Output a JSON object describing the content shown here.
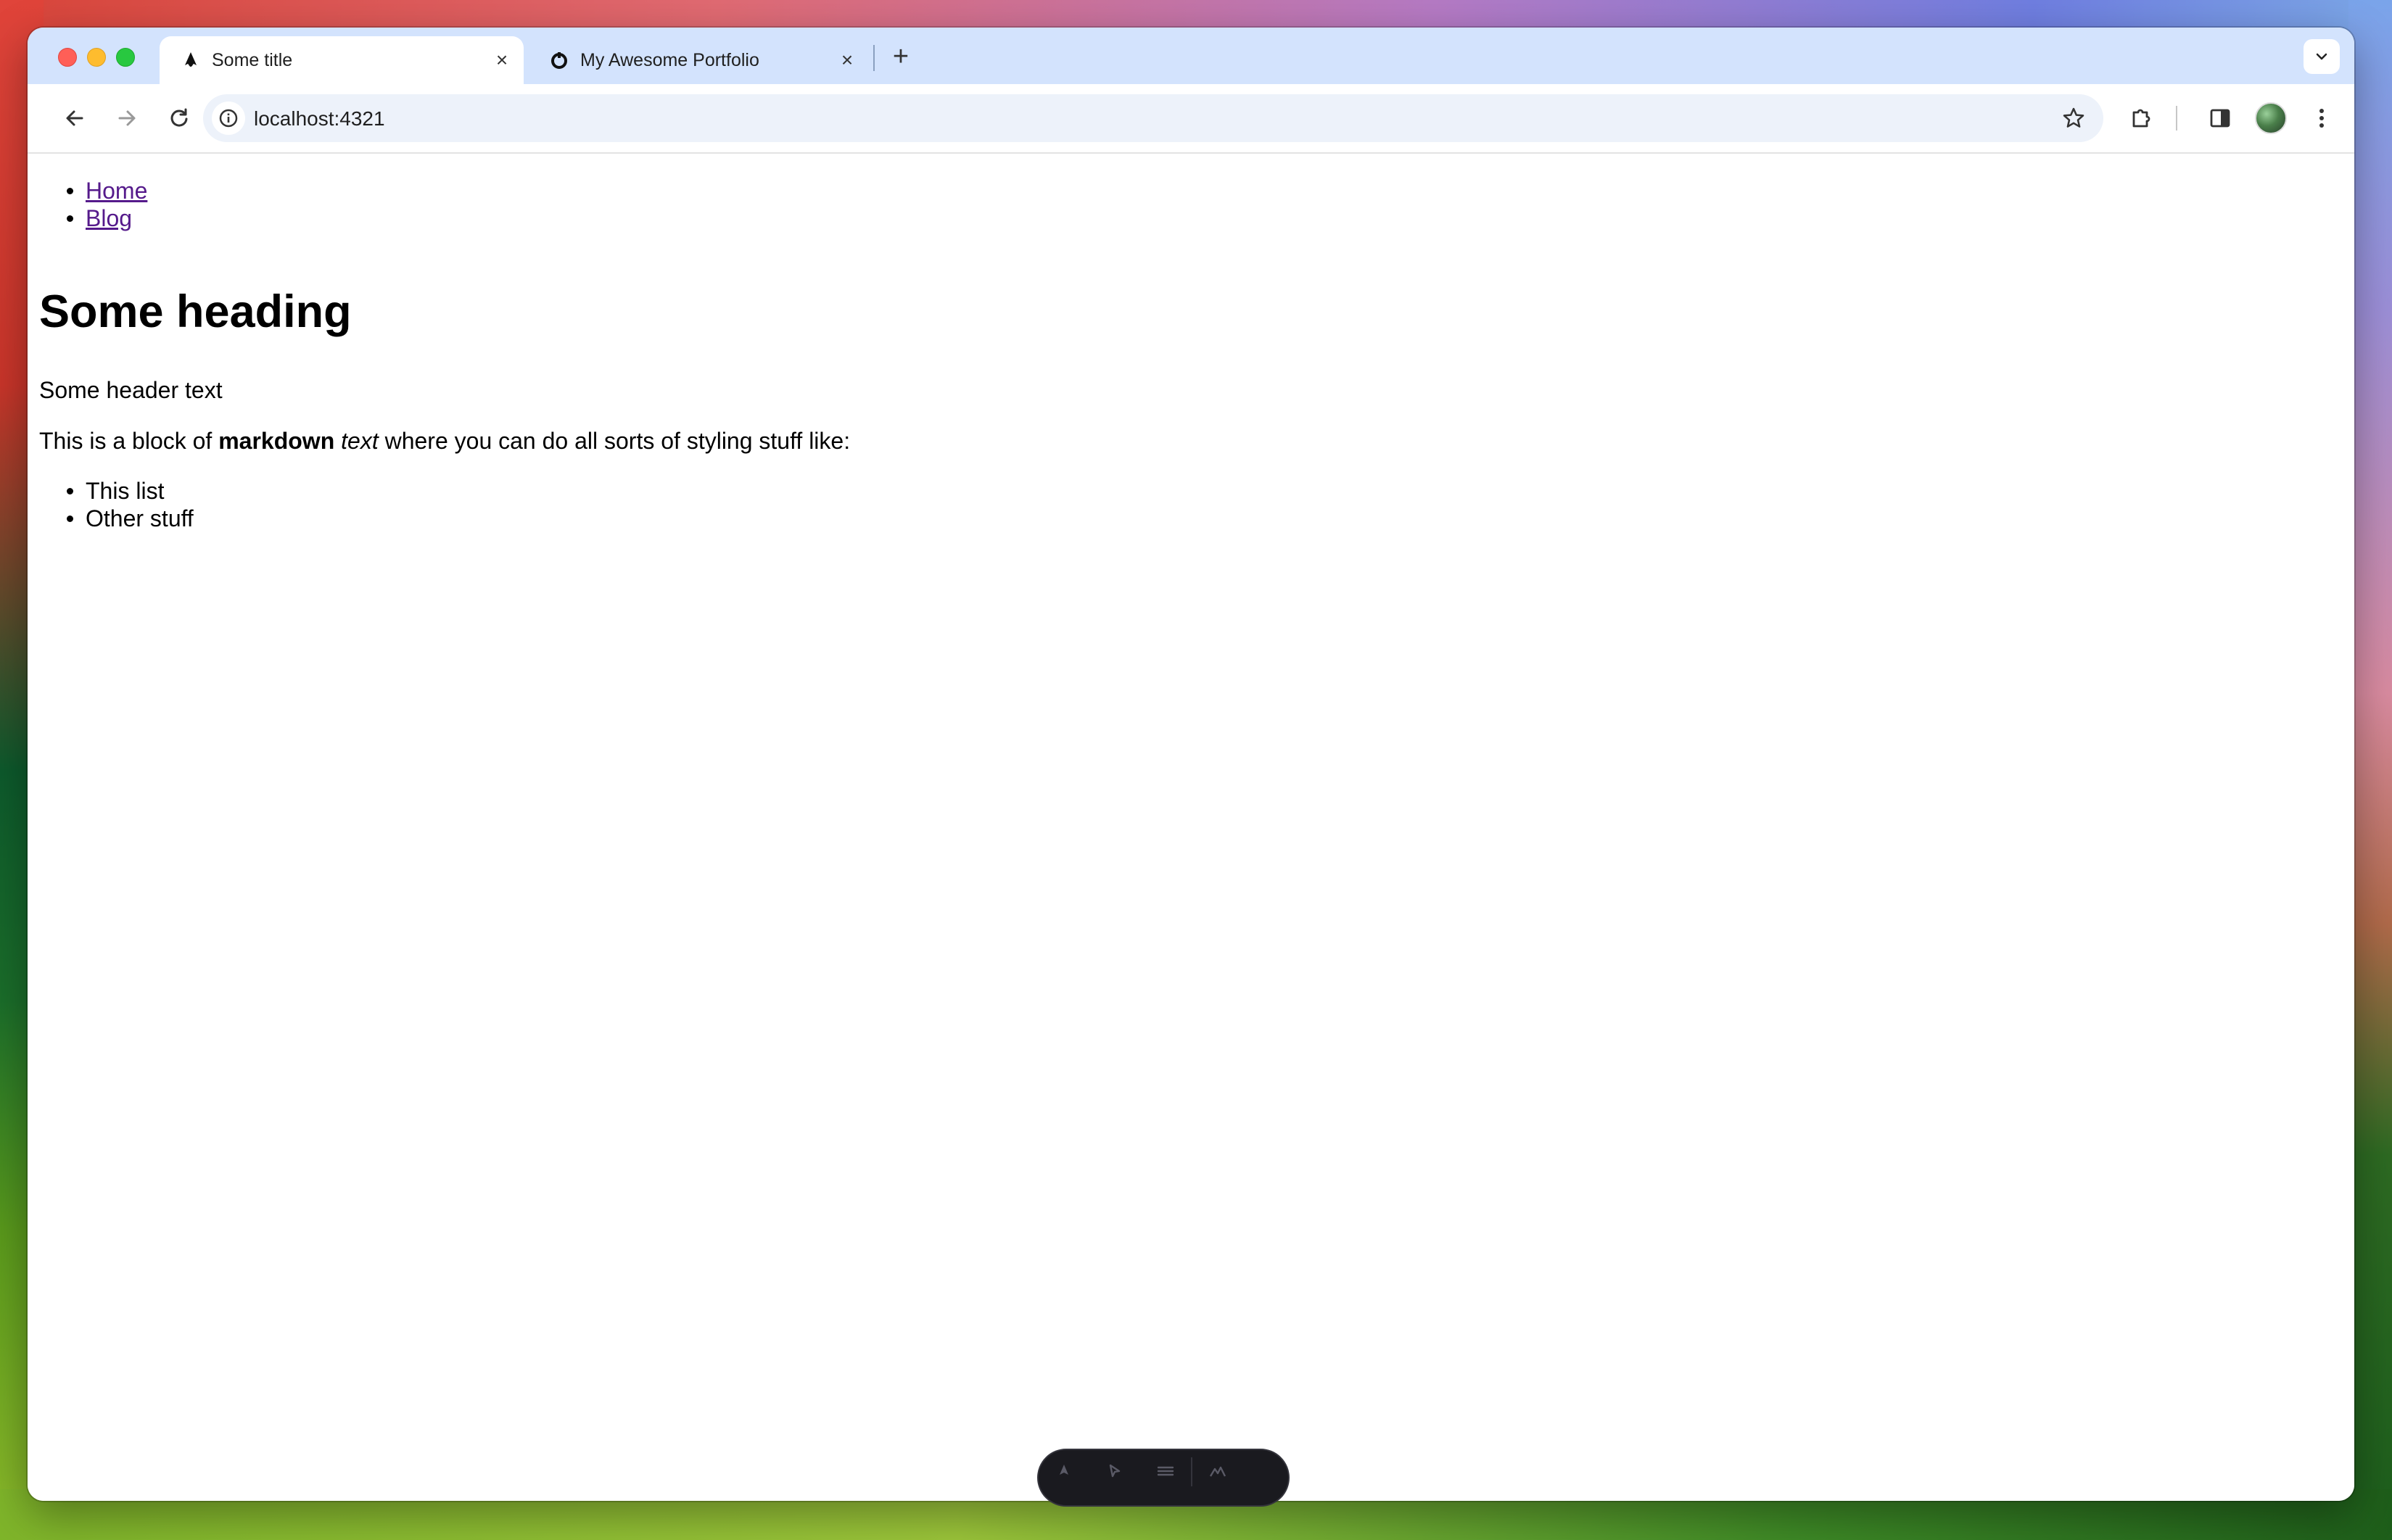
{
  "browser": {
    "tabs": [
      {
        "title": "Some title",
        "favicon": "astro-icon",
        "active": true
      },
      {
        "title": "My Awesome Portfolio",
        "favicon": "portfolio-icon",
        "active": false
      }
    ],
    "address": "localhost:4321"
  },
  "page": {
    "nav": [
      "Home",
      "Blog"
    ],
    "heading": "Some heading",
    "header_text": "Some header text",
    "paragraph": {
      "prefix": "This is a block of ",
      "bold": "markdown",
      "italic": "text",
      "suffix": " where you can do all sorts of styling stuff like:"
    },
    "list": [
      "This list",
      "Other stuff"
    ]
  },
  "dev_toolbar": {
    "icons": [
      "astro-menu-icon",
      "pointer-icon",
      "settings-icon",
      "close-icon"
    ]
  }
}
